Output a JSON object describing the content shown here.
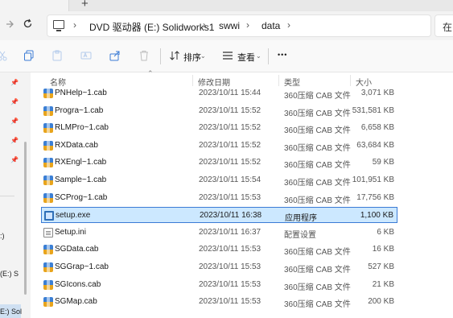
{
  "tabstrip": {
    "new_tab_glyph": "+"
  },
  "address": {
    "crumbs": [
      "DVD 驱动器 (E:) Solidworks1",
      "swwi",
      "data"
    ],
    "search_partial": "在"
  },
  "toolbar": {
    "sort_label": "排序",
    "view_label": "查看",
    "more_glyph": "•••"
  },
  "navpane": {
    "items": [
      ":)",
      "(E:) S",
      "E:) Sol"
    ]
  },
  "columns": {
    "name": "名称",
    "date": "修改日期",
    "type": "类型",
    "size": "大小"
  },
  "files": [
    {
      "name": "PNHelp~1.cab",
      "date": "2023/10/11 15:44",
      "type": "360压缩 CAB 文件",
      "size": "3,071 KB",
      "icon": "cab-icon",
      "selected": false
    },
    {
      "name": "Progra~1.cab",
      "date": "2023/10/11 15:52",
      "type": "360压缩 CAB 文件",
      "size": "531,581 KB",
      "icon": "cab-icon",
      "selected": false
    },
    {
      "name": "RLMPro~1.cab",
      "date": "2023/10/11 15:52",
      "type": "360压缩 CAB 文件",
      "size": "6,658 KB",
      "icon": "cab-icon",
      "selected": false
    },
    {
      "name": "RXData.cab",
      "date": "2023/10/11 15:52",
      "type": "360压缩 CAB 文件",
      "size": "63,684 KB",
      "icon": "cab-icon",
      "selected": false
    },
    {
      "name": "RXEngl~1.cab",
      "date": "2023/10/11 15:52",
      "type": "360压缩 CAB 文件",
      "size": "59 KB",
      "icon": "cab-icon",
      "selected": false
    },
    {
      "name": "Sample~1.cab",
      "date": "2023/10/11 15:54",
      "type": "360压缩 CAB 文件",
      "size": "101,951 KB",
      "icon": "cab-icon",
      "selected": false
    },
    {
      "name": "SCProg~1.cab",
      "date": "2023/10/11 15:53",
      "type": "360压缩 CAB 文件",
      "size": "17,756 KB",
      "icon": "cab-icon",
      "selected": false
    },
    {
      "name": "setup.exe",
      "date": "2023/10/11 16:38",
      "type": "应用程序",
      "size": "1,100 KB",
      "icon": "exe-icon",
      "selected": true
    },
    {
      "name": "Setup.ini",
      "date": "2023/10/11 16:37",
      "type": "配置设置",
      "size": "6 KB",
      "icon": "ini-icon",
      "selected": false
    },
    {
      "name": "SGData.cab",
      "date": "2023/10/11 15:53",
      "type": "360压缩 CAB 文件",
      "size": "16 KB",
      "icon": "cab-icon",
      "selected": false
    },
    {
      "name": "SGGrap~1.cab",
      "date": "2023/10/11 15:53",
      "type": "360压缩 CAB 文件",
      "size": "527 KB",
      "icon": "cab-icon",
      "selected": false
    },
    {
      "name": "SGIcons.cab",
      "date": "2023/10/11 15:53",
      "type": "360压缩 CAB 文件",
      "size": "21 KB",
      "icon": "cab-icon",
      "selected": false
    },
    {
      "name": "SGMap.cab",
      "date": "2023/10/11 15:53",
      "type": "360压缩 CAB 文件",
      "size": "200 KB",
      "icon": "cab-icon",
      "selected": false
    }
  ]
}
